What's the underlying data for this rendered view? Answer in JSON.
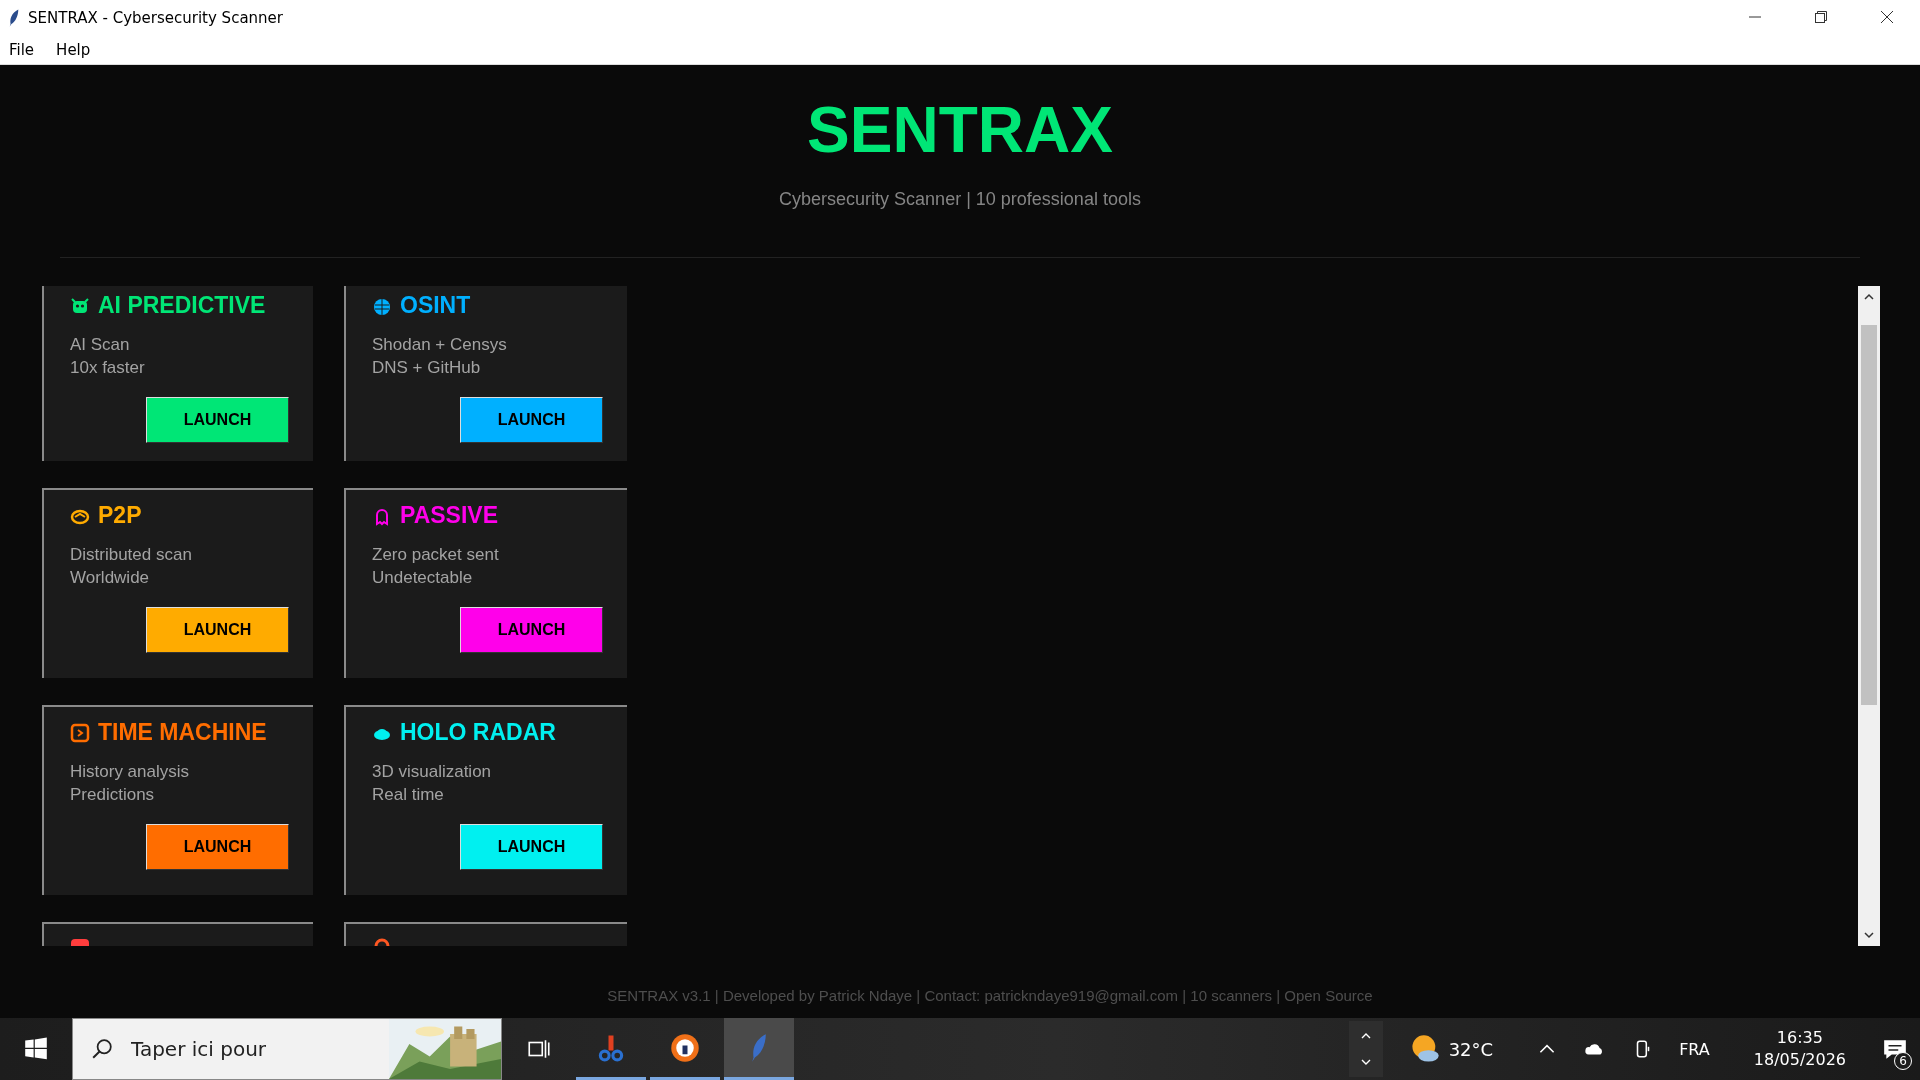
{
  "window": {
    "title": "SENTRAX - Cybersecurity Scanner"
  },
  "menu": [
    "File",
    "Help"
  ],
  "header": {
    "title": "SENTRAX",
    "subtitle": "Cybersecurity Scanner | 10 professional tools"
  },
  "cards": [
    {
      "kind": "robot",
      "title": "AI PREDICTIVE",
      "color": "#00e676",
      "lines": [
        "AI Scan",
        "10x faster"
      ],
      "button": "LAUNCH"
    },
    {
      "kind": "globe",
      "title": "OSINT",
      "color": "#00b0ff",
      "lines": [
        "Shodan + Censys",
        "DNS + GitHub"
      ],
      "button": "LAUNCH"
    },
    {
      "kind": "handshake",
      "title": "P2P",
      "color": "#ffab00",
      "lines": [
        "Distributed scan",
        "Worldwide"
      ],
      "button": "LAUNCH"
    },
    {
      "kind": "ghost",
      "title": "PASSIVE",
      "color": "#ff00ea",
      "lines": [
        "Zero packet sent",
        "Undetectable"
      ],
      "button": "LAUNCH"
    },
    {
      "kind": "clock",
      "title": "TIME MACHINE",
      "color": "#ff6d00",
      "lines": [
        "History analysis",
        "Predictions"
      ],
      "button": "LAUNCH"
    },
    {
      "kind": "cloud",
      "title": "HOLO RADAR",
      "color": "#00f0f0",
      "lines": [
        "3D visualization",
        "Real time"
      ],
      "button": "LAUNCH"
    },
    {
      "kind": "tag",
      "color": "#ff3d3d"
    },
    {
      "kind": "ring",
      "color": "#ff5722"
    }
  ],
  "footer": "SENTRAX v3.1 | Developed by Patrick Ndaye | Contact: patrickndaye919@gmail.com | 10 scanners | Open Source",
  "taskbar": {
    "search_placeholder": "Taper ici pour",
    "temperature": "32°C",
    "language": "FRA",
    "time": "16:35",
    "date": "18/05/2026",
    "notifications": "6"
  }
}
